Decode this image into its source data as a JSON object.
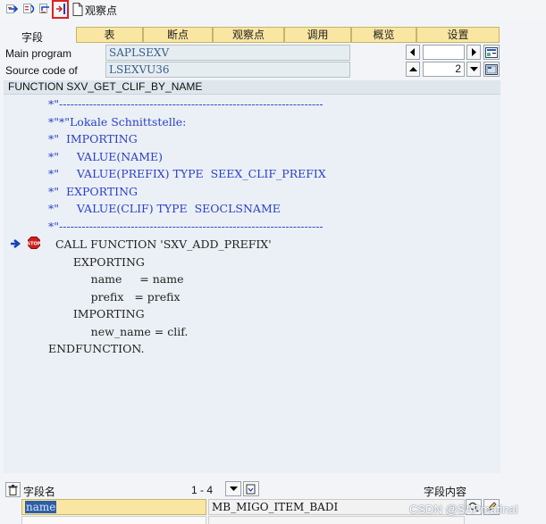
{
  "toolbar": {
    "buttons": [
      "step-into-icon",
      "step-over-icon",
      "return-icon",
      "continue-icon"
    ],
    "watchpoint_label": "观察点"
  },
  "tabs": {
    "field_label": "字段",
    "items": [
      "表",
      "断点",
      "观察点",
      "调用",
      "概览",
      "设置"
    ]
  },
  "info": {
    "main_program_label": "Main program",
    "main_program_value": "SAPLSEXV",
    "source_code_label": "Source code of",
    "source_code_value": "LSEXVU36",
    "line_number": "2"
  },
  "function_header": "FUNCTION SXV_GET_CLIF_BY_NAME",
  "code_lines": [
    {
      "text": "*\"----------------------------------------------------------------------",
      "type": "comment"
    },
    {
      "text": "*\"*\"Lokale Schnittstelle:",
      "type": "comment"
    },
    {
      "text": "*\"  IMPORTING",
      "type": "comment"
    },
    {
      "text": "*\"     VALUE(NAME)",
      "type": "comment"
    },
    {
      "text": "*\"     VALUE(PREFIX) TYPE  SEEX_CLIF_PREFIX",
      "type": "comment"
    },
    {
      "text": "*\"  EXPORTING",
      "type": "comment"
    },
    {
      "text": "*\"     VALUE(CLIF) TYPE  SEOCLSNAME",
      "type": "comment"
    },
    {
      "text": "*\"----------------------------------------------------------------------",
      "type": "comment"
    },
    {
      "text": "  CALL FUNCTION 'SXV_ADD_PREFIX'",
      "type": "code"
    },
    {
      "text": "       EXPORTING",
      "type": "code"
    },
    {
      "text": "            name     = name",
      "type": "code"
    },
    {
      "text": "            prefix   = prefix",
      "type": "code"
    },
    {
      "text": "       IMPORTING",
      "type": "code"
    },
    {
      "text": "            new_name = clif.",
      "type": "code"
    },
    {
      "text": "ENDFUNCTION.",
      "type": "code"
    }
  ],
  "bottom": {
    "field_name_label": "字段名",
    "range": "1 - 4",
    "field_content_label": "字段内容",
    "var_name": "name",
    "var_value": "MB_MIGO_ITEM_BADI"
  },
  "watermark": "CSDN @SAPmatinal",
  "colors": {
    "tab_bg": "#f9e6a2",
    "comment": "#2c3fc8",
    "field_bg": "#e6edf1",
    "highlight_frame": "#e02020"
  }
}
